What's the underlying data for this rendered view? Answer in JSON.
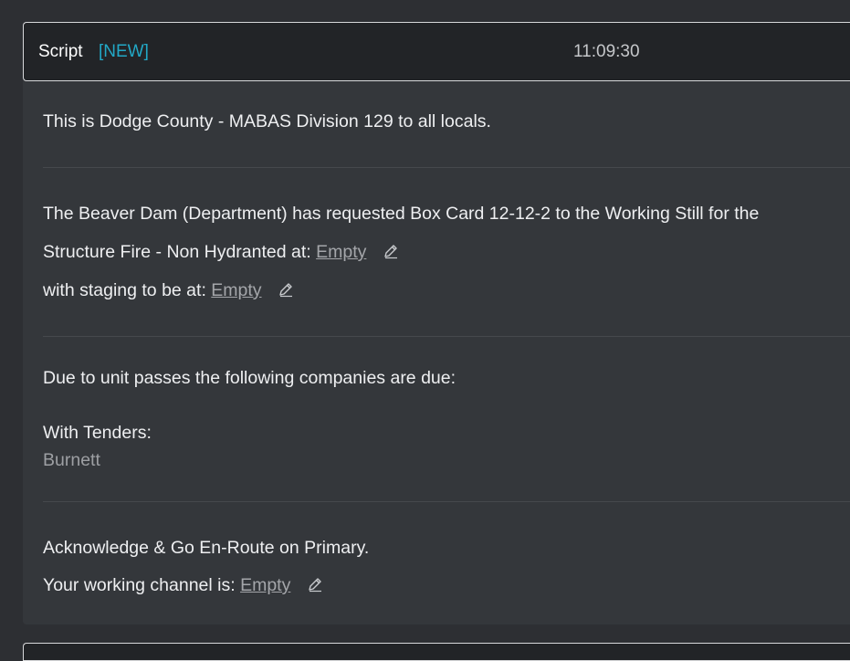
{
  "header": {
    "title": "Script",
    "badge": "[NEW]",
    "time": "11:09:30"
  },
  "script": {
    "intro": "This is Dodge County - MABAS Division 129 to all locals.",
    "request_line1": "The Beaver Dam (Department) has requested Box Card 12-12-2 to the Working Still for the",
    "request_line2_prefix": "Structure Fire - Non Hydranted at:",
    "location_value": "Empty",
    "staging_prefix": "with staging to be at:",
    "staging_value": "Empty",
    "due_line": "Due to unit passes the following companies are due:",
    "tenders_heading": "With Tenders:",
    "tenders": [
      "Burnett"
    ],
    "acknowledge_line": "Acknowledge & Go En-Route on Primary.",
    "channel_prefix": "Your working channel is:",
    "channel_value": "Empty"
  },
  "icons": {
    "edit": "pencil-icon"
  },
  "colors": {
    "page_bg": "#2d2f33",
    "panel_bg": "#34373b",
    "header_bg": "#222427",
    "accent": "#22a8c6"
  }
}
